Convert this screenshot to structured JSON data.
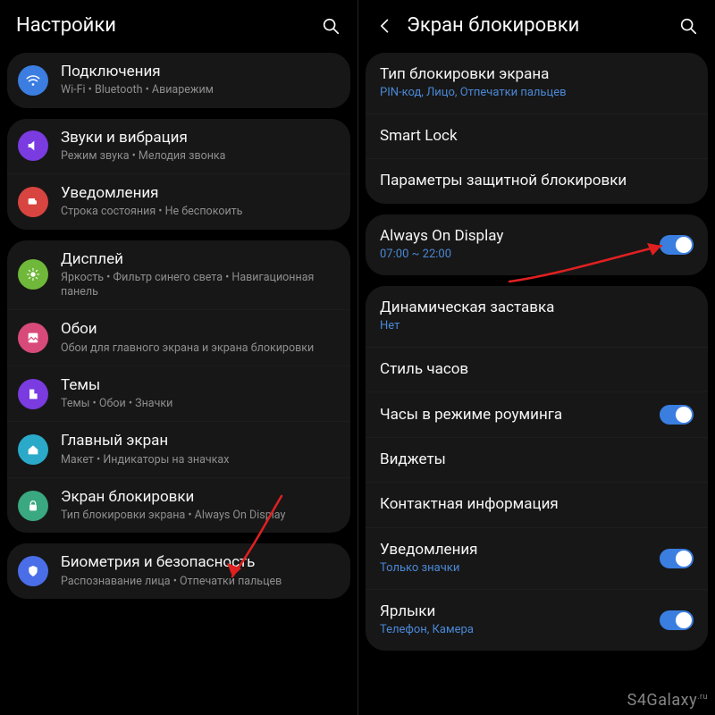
{
  "left": {
    "title": "Настройки",
    "groups": [
      {
        "items": [
          {
            "icon": "wifi",
            "color": "#3b7de0",
            "title": "Подключения",
            "sub": "Wi-Fi • Bluetooth • Авиарежим"
          }
        ]
      },
      {
        "items": [
          {
            "icon": "sound",
            "color": "#7a3be0",
            "title": "Звуки и вибрация",
            "sub": "Режим звука • Мелодия звонка"
          },
          {
            "icon": "notif",
            "color": "#d8443f",
            "title": "Уведомления",
            "sub": "Строка состояния • Не беспокоить"
          }
        ]
      },
      {
        "items": [
          {
            "icon": "display",
            "color": "#6fb83a",
            "title": "Дисплей",
            "sub": "Яркость • Фильтр синего света • Навигационная панель"
          },
          {
            "icon": "wall",
            "color": "#d84a7a",
            "title": "Обои",
            "sub": "Обои для главного экрана и экрана блокировки"
          },
          {
            "icon": "themes",
            "color": "#7a3be0",
            "title": "Темы",
            "sub": "Темы • Обои • Значки"
          },
          {
            "icon": "home",
            "color": "#2aa9c9",
            "title": "Главный экран",
            "sub": "Макет • Индикаторы на значках"
          },
          {
            "icon": "lock",
            "color": "#3aa880",
            "title": "Экран блокировки",
            "sub": "Тип блокировки экрана • Always On Display"
          }
        ]
      },
      {
        "items": [
          {
            "icon": "shield",
            "color": "#4a6ee8",
            "title": "Биометрия и безопасность",
            "sub": "Распознавание лица • Отпечатки пальцев"
          }
        ]
      }
    ]
  },
  "right": {
    "title": "Экран блокировки",
    "groups": [
      {
        "rows": [
          {
            "title": "Тип блокировки экрана",
            "subBlue": "PIN-код, Лицо, Отпечатки пальцев"
          },
          {
            "title": "Smart Lock"
          },
          {
            "title": "Параметры защитной блокировки"
          }
        ]
      },
      {
        "rows": [
          {
            "title": "Always On Display",
            "subBlue": "07:00 ~ 22:00",
            "toggle": "on"
          }
        ]
      },
      {
        "rows": [
          {
            "title": "Динамическая заставка",
            "subBlue": "Нет"
          },
          {
            "title": "Стиль часов"
          },
          {
            "title": "Часы в режиме роуминга",
            "toggle": "on"
          },
          {
            "title": "Виджеты"
          },
          {
            "title": "Контактная информация"
          },
          {
            "title": "Уведомления",
            "subBlue": "Только значки",
            "toggle": "on"
          },
          {
            "title": "Ярлыки",
            "subBlue": "Телефон, Камера",
            "toggle": "on"
          }
        ]
      }
    ]
  },
  "watermark": "S4Galaxy",
  "watermark_suffix": ".ru"
}
